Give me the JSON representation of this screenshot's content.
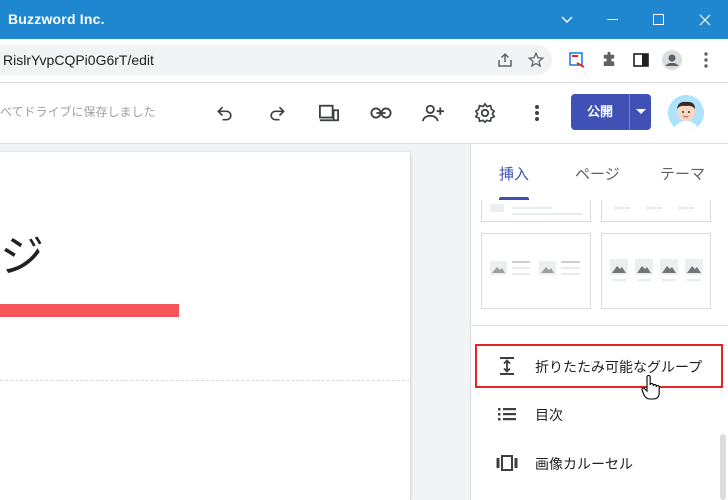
{
  "window": {
    "title": "Buzzword Inc."
  },
  "address": {
    "url": "RislrYvpCQPi0G6rT/edit"
  },
  "toolbar": {
    "save_status": "べてドライブに保存しました",
    "publish_label": "公開"
  },
  "canvas": {
    "title_text": "ジ"
  },
  "panel": {
    "tabs": [
      {
        "label": "挿入"
      },
      {
        "label": "ページ"
      },
      {
        "label": "テーマ"
      }
    ],
    "items": [
      {
        "label": "折りたたみ可能なグループ",
        "icon": "expand-vertical-icon"
      },
      {
        "label": "目次",
        "icon": "toc-list-icon"
      },
      {
        "label": "画像カルーセル",
        "icon": "carousel-icon"
      }
    ]
  },
  "colors": {
    "titlebar": "#1f86d0",
    "accent": "#3f51b5",
    "highlight_border": "#e52525",
    "title_underline": "#f4545a"
  }
}
